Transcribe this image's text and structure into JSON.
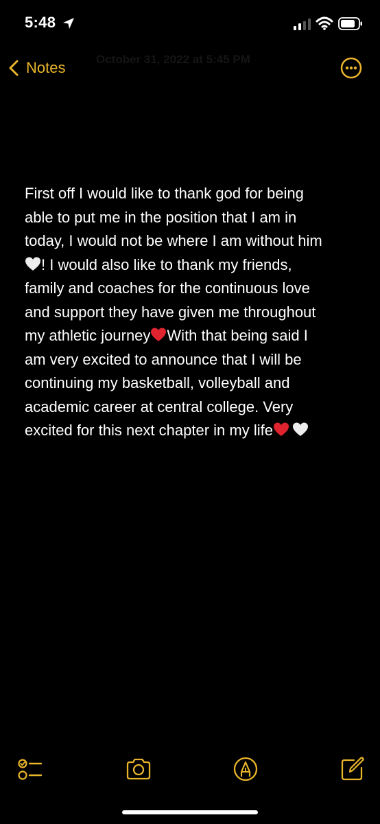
{
  "status_bar": {
    "time": "5:48",
    "icons": [
      "location-arrow-icon",
      "cellular-signal-icon",
      "wifi-icon",
      "battery-icon"
    ]
  },
  "nav": {
    "back_label": "Notes",
    "date": "October 31, 2022 at 5:45 PM",
    "more_icon": "ellipsis-circle-icon"
  },
  "note": {
    "lines": [
      "First off I would like to thank god for being",
      "able to put me in the position that I am in",
      "today, I would not be where I am without him",
      "! I would also like to thank my friends,",
      "family and coaches for the continuous love",
      "and support they have given me throughout",
      "my athletic journey",
      "With that being said I",
      "am very excited to announce that I will be",
      "continuing my basketball, volleyball and",
      "academic career at central college. Very",
      "excited for this next chapter in my life"
    ],
    "emojis": [
      "white-heart",
      "red-heart",
      "red-heart",
      "white-heart"
    ]
  },
  "toolbar": {
    "items": [
      "checklist-icon",
      "camera-icon",
      "markup-pen-icon",
      "compose-icon"
    ]
  },
  "colors": {
    "accent": "#e9b52b",
    "background": "#000000",
    "text": "#ffffff",
    "red_heart": "#e0242f",
    "white_heart": "#ededed"
  }
}
